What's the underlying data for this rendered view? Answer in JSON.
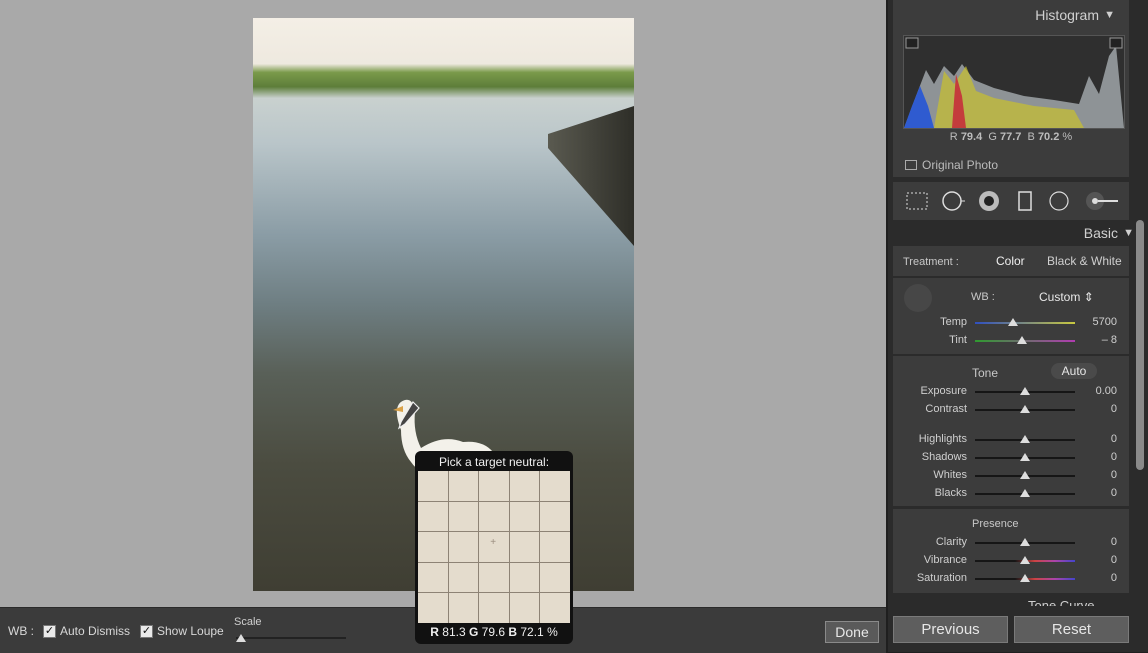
{
  "toolbar": {
    "wb_label": "WB :",
    "auto_dismiss_label": "Auto Dismiss",
    "auto_dismiss_checked": true,
    "show_loupe_label": "Show Loupe",
    "show_loupe_checked": true,
    "scale_label": "Scale",
    "done_label": "Done"
  },
  "loupe": {
    "title": "Pick a target neutral:",
    "r_label": "R",
    "r_value": "81.3",
    "g_label": "G",
    "g_value": "79.6",
    "b_label": "B",
    "b_value": "72.1",
    "unit": "%"
  },
  "histogram": {
    "title": "Histogram",
    "r_label": "R",
    "r_value": "79.4",
    "g_label": "G",
    "g_value": "77.7",
    "b_label": "B",
    "b_value": "70.2",
    "unit": "%",
    "original_photo_label": "Original Photo"
  },
  "tools": [
    "crop-overlay-icon",
    "spot-removal-icon",
    "red-eye-icon",
    "graduated-filter-icon",
    "radial-filter-icon",
    "adjustment-brush-icon"
  ],
  "basic": {
    "title": "Basic",
    "treatment_label": "Treatment :",
    "treatment_color": "Color",
    "treatment_bw": "Black & White",
    "wb_label": "WB :",
    "wb_value": "Custom",
    "temp_label": "Temp",
    "temp_value": "5700",
    "temp_pos": 0.38,
    "tint_label": "Tint",
    "tint_value": "– 8",
    "tint_pos": 0.47,
    "tone_label": "Tone",
    "auto_label": "Auto",
    "sliders": [
      {
        "label": "Exposure",
        "value": "0.00"
      },
      {
        "label": "Contrast",
        "value": "0"
      },
      {
        "label": "Highlights",
        "value": "0"
      },
      {
        "label": "Shadows",
        "value": "0"
      },
      {
        "label": "Whites",
        "value": "0"
      },
      {
        "label": "Blacks",
        "value": "0"
      }
    ],
    "presence_label": "Presence",
    "presence": [
      {
        "label": "Clarity",
        "value": "0"
      },
      {
        "label": "Vibrance",
        "value": "0"
      },
      {
        "label": "Saturation",
        "value": "0"
      }
    ],
    "tone_curve_label": "Tone Curve"
  },
  "footer": {
    "previous_label": "Previous",
    "reset_label": "Reset"
  }
}
